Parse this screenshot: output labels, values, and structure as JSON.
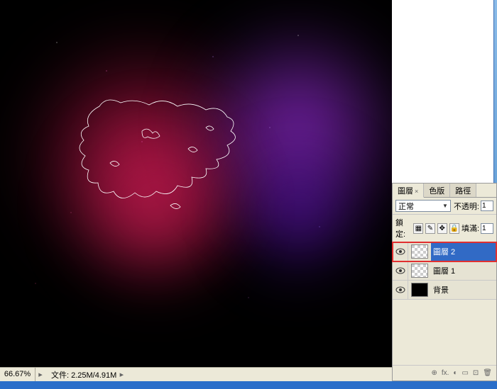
{
  "status": {
    "zoom": "66.67%",
    "file_label": "文件: 2.25M/4.91M"
  },
  "panel": {
    "tabs": {
      "layers": "圖層",
      "channels": "色版",
      "paths": "路徑"
    },
    "blend_mode": "正常",
    "opacity_label": "不透明:",
    "opacity_value": "1",
    "lock_label": "鎖定:",
    "fill_label": "填滿:",
    "fill_value": "1",
    "layers": [
      {
        "name": "圖層 2",
        "selected": true,
        "thumb": "checker"
      },
      {
        "name": "圖層 1",
        "selected": false,
        "thumb": "checker"
      },
      {
        "name": "背景",
        "selected": false,
        "thumb": "solid"
      }
    ],
    "footer_icons": [
      "⊕",
      "fx.",
      "◐",
      "▭",
      "⊡",
      "🗑"
    ]
  }
}
